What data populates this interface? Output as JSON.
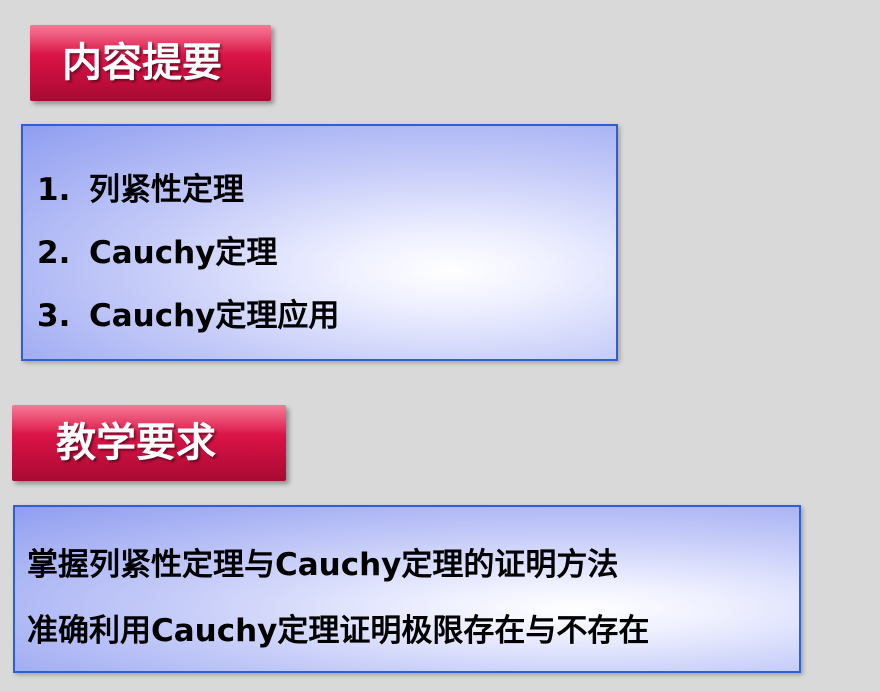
{
  "summary": {
    "title": "内容提要",
    "items": [
      {
        "number": "1.",
        "text": "列紧性定理"
      },
      {
        "number": "2.",
        "text": "Cauchy定理"
      },
      {
        "number": "3.",
        "text": "Cauchy定理应用"
      }
    ]
  },
  "requirements": {
    "title": "教学要求",
    "lines": [
      "掌握列紧性定理与Cauchy定理的证明方法",
      "准确利用Cauchy定理证明极限存在与不存在"
    ]
  },
  "colors": {
    "background": "#d9d9d9",
    "tab_red": "#d71245",
    "panel_border": "#2f5fd0",
    "panel_blue": "#8f9df0"
  }
}
